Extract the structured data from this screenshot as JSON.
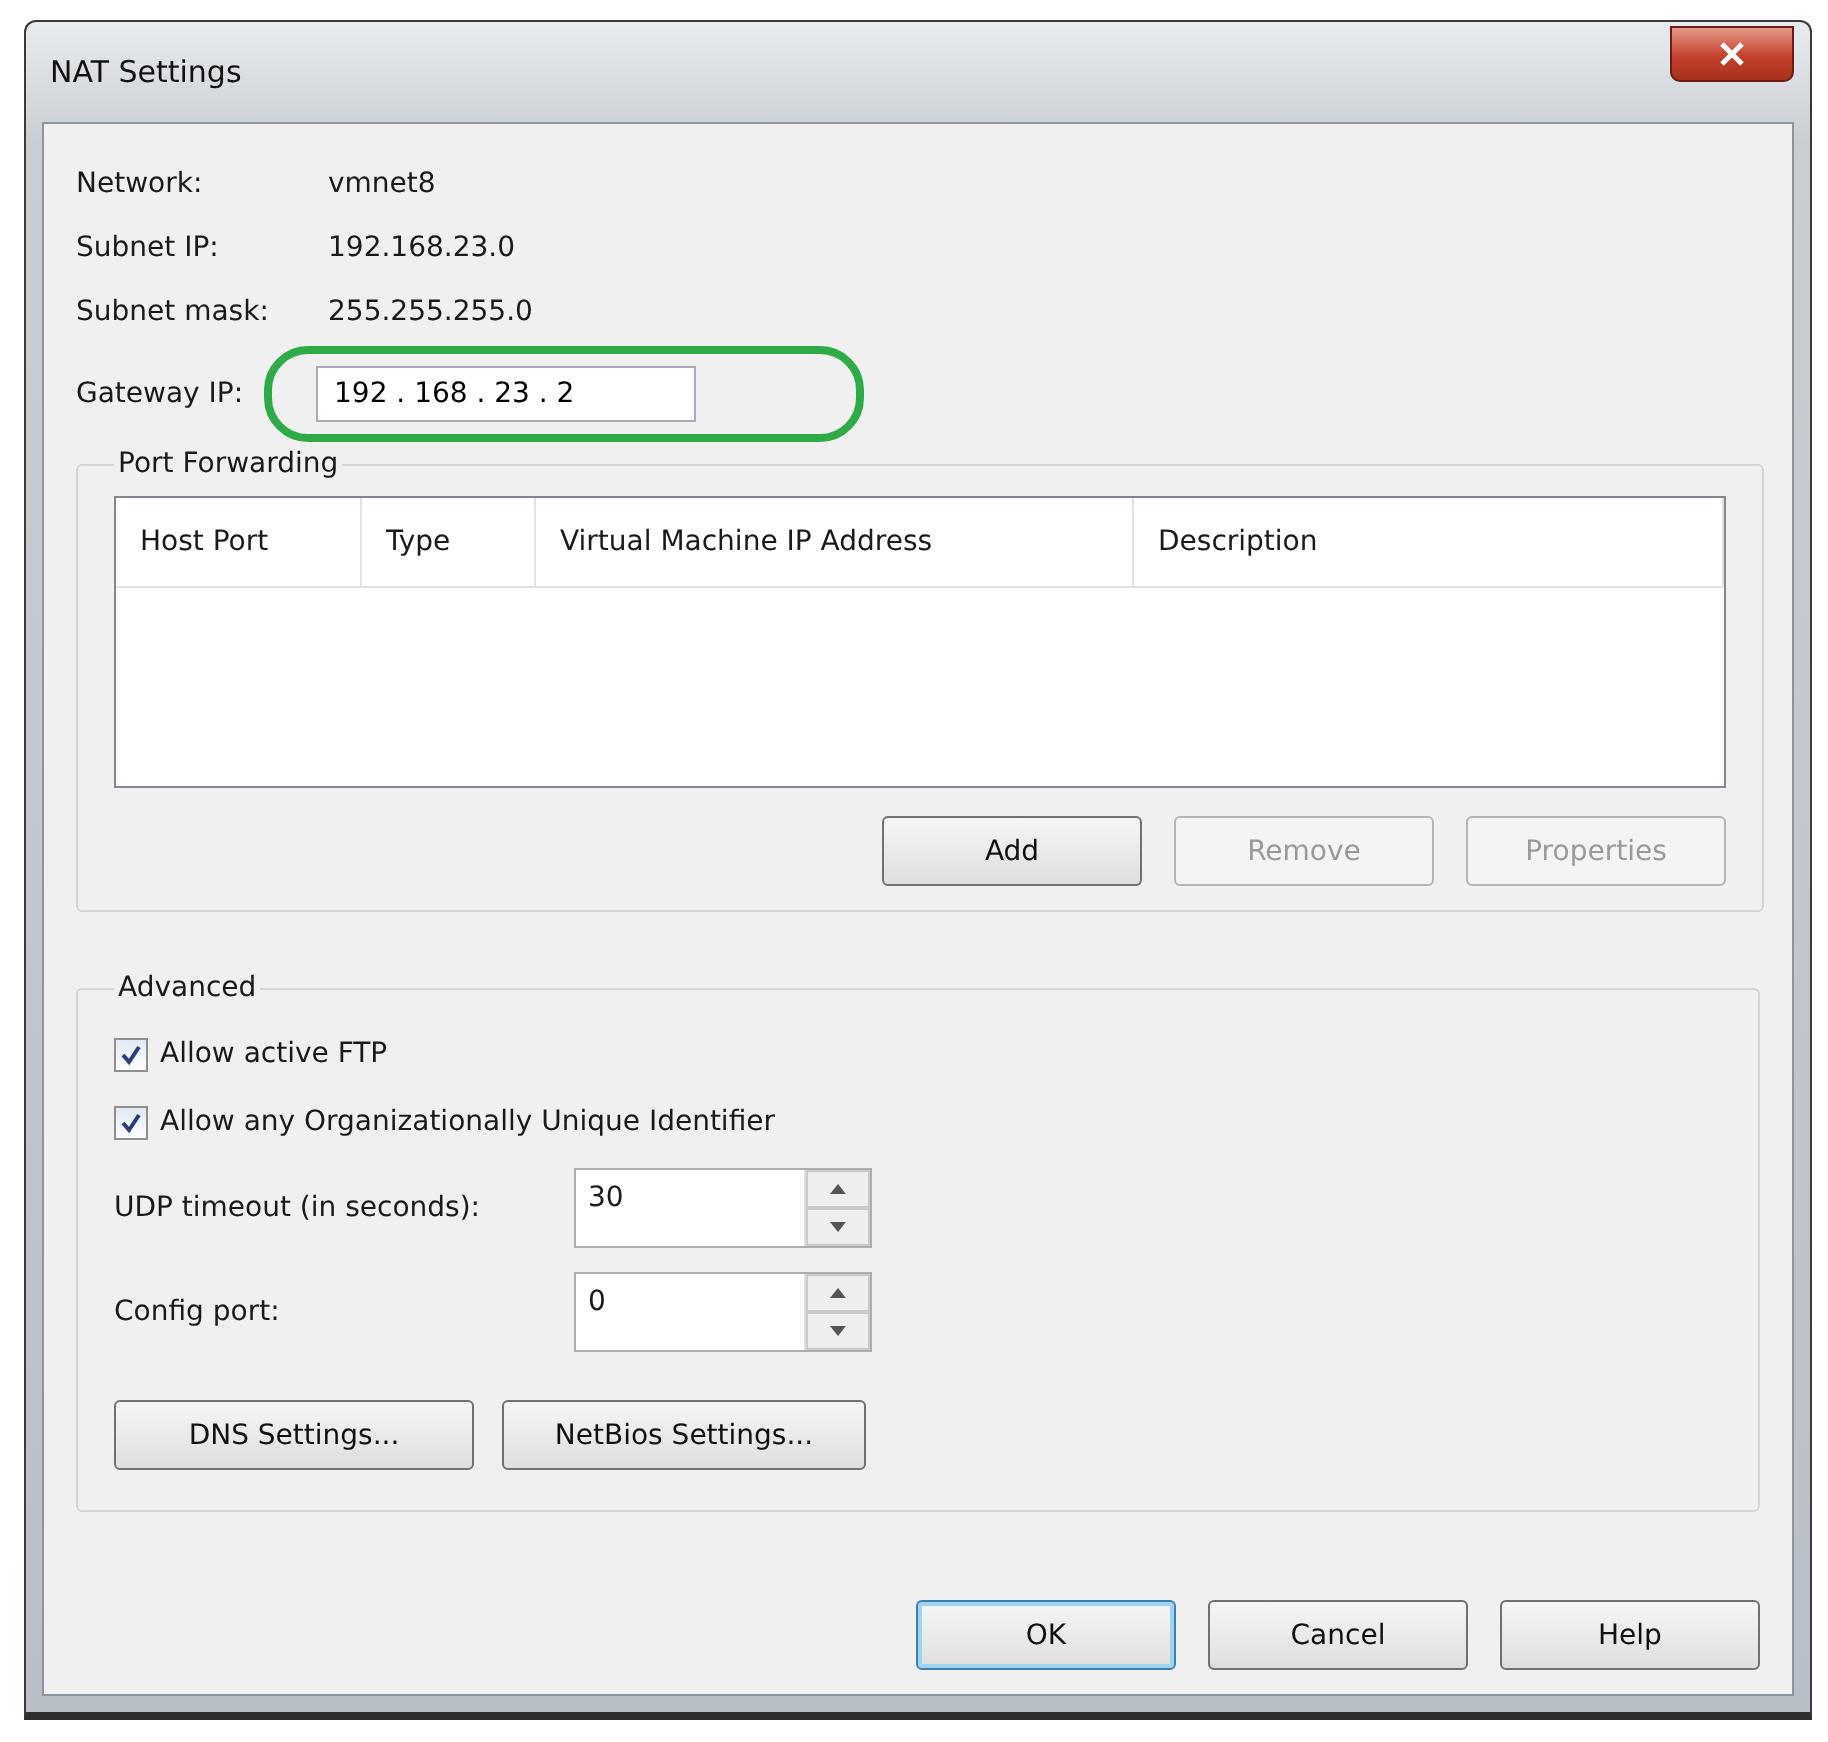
{
  "window": {
    "title": "NAT Settings"
  },
  "info": [
    {
      "label": "Network:",
      "value": "vmnet8"
    },
    {
      "label": "Subnet IP:",
      "value": "192.168.23.0"
    },
    {
      "label": "Subnet mask:",
      "value": "255.255.255.0"
    }
  ],
  "gateway": {
    "label": "Gateway IP:",
    "value": "192 . 168 . 23 . 2",
    "highlighted": true
  },
  "port_forwarding": {
    "title": "Port Forwarding",
    "columns": [
      "Host Port",
      "Type",
      "Virtual Machine IP Address",
      "Description"
    ],
    "buttons": [
      {
        "label": "Add",
        "disabled": false
      },
      {
        "label": "Remove",
        "disabled": true
      },
      {
        "label": "Properties",
        "disabled": true
      }
    ]
  },
  "advanced": {
    "title": "Advanced",
    "checkboxes": [
      {
        "label": "Allow active FTP",
        "checked": true
      },
      {
        "label": "Allow any Organizationally Unique Identifier",
        "checked": true
      }
    ],
    "spinners": [
      {
        "label": "UDP timeout (in seconds):",
        "value": "30"
      },
      {
        "label": "Config port:",
        "value": "0"
      }
    ],
    "buttons": [
      "DNS Settings...",
      "NetBios Settings..."
    ]
  },
  "footer": [
    {
      "label": "OK",
      "default": true
    },
    {
      "label": "Cancel",
      "default": false
    },
    {
      "label": "Help",
      "default": false
    }
  ]
}
